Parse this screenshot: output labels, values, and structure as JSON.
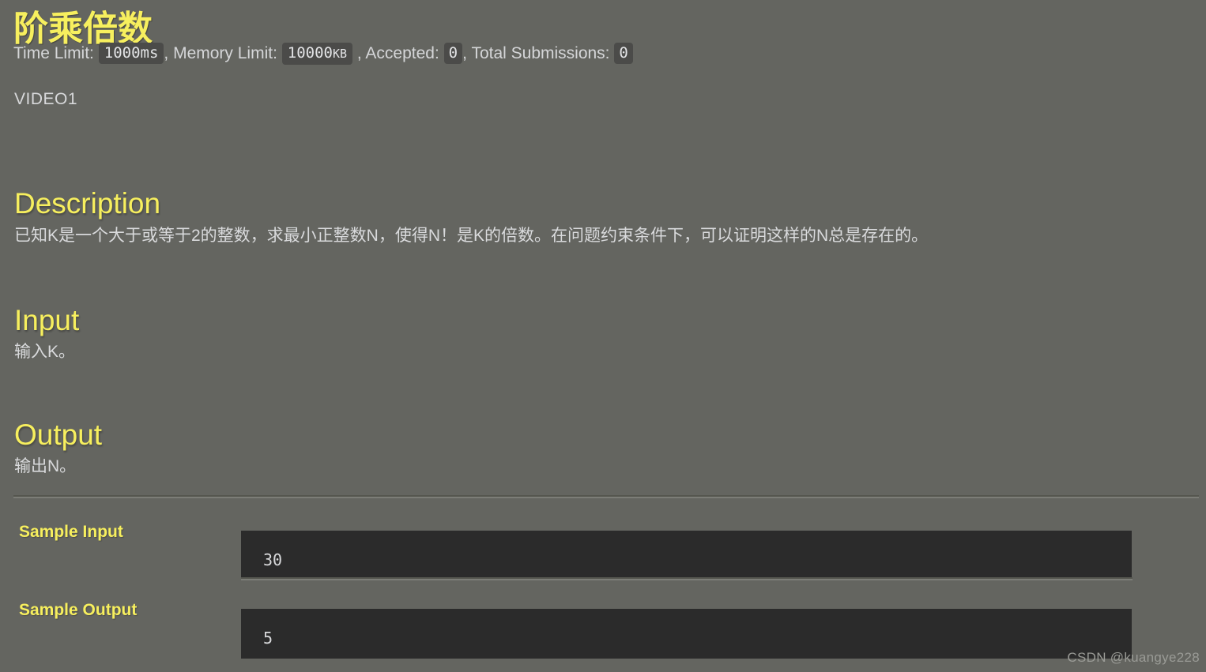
{
  "problem": {
    "title": "阶乘倍数",
    "video_tag": "VIDEO1"
  },
  "meta": {
    "time_limit_label": "Time Limit:",
    "time_limit_value": "1000ms",
    "separator_1": ",",
    "memory_limit_label": "Memory Limit:",
    "memory_limit_value": "10000",
    "memory_limit_unit": "KB",
    "separator_2": ",",
    "accepted_label": "Accepted:",
    "accepted_value": "0",
    "separator_3": ",",
    "total_submissions_label": "Total Submissions:",
    "total_submissions_value": "0"
  },
  "sections": {
    "description": {
      "heading": "Description",
      "body": "已知K是一个大于或等于2的整数，求最小正整数N，使得N！是K的倍数。在问题约束条件下，可以证明这样的N总是存在的。"
    },
    "input": {
      "heading": "Input",
      "body": "输入K。"
    },
    "output": {
      "heading": "Output",
      "body": "输出N。"
    }
  },
  "samples": {
    "input_label": "Sample Input",
    "input_value": "30",
    "output_label": "Sample Output",
    "output_value": "5"
  },
  "watermark": {
    "text": "CSDN @kuangye228"
  },
  "colors": {
    "page_background": "#646560",
    "heading_yellow": "#f7ef5e",
    "body_text": "#d9dadc",
    "badge_background": "#4b4b49",
    "code_background": "#2b2b2b"
  }
}
